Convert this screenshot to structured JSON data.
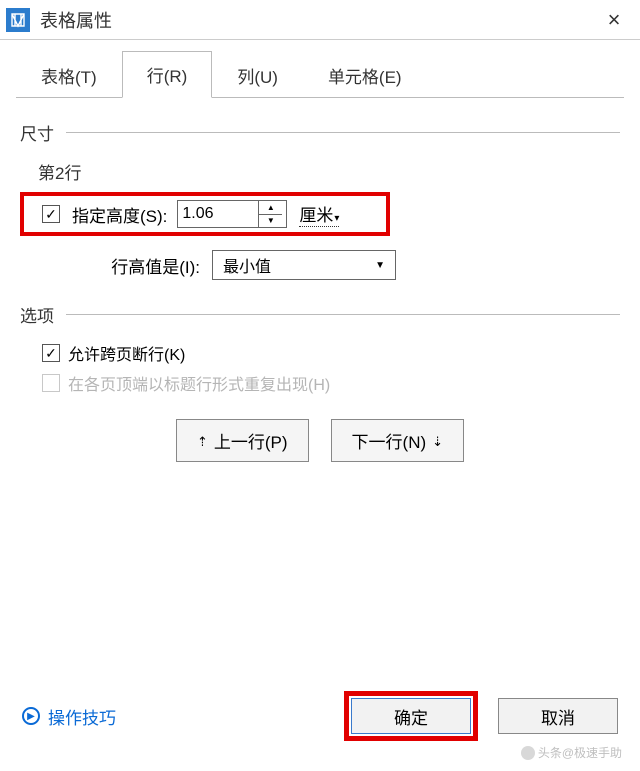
{
  "window": {
    "title": "表格属性",
    "close_symbol": "×"
  },
  "tabs": {
    "table": "表格(T)",
    "row": "行(R)",
    "column": "列(U)",
    "cell": "单元格(E)",
    "active": "row"
  },
  "size_section": {
    "header": "尺寸",
    "row_label": "第2行",
    "specify_height_label": "指定高度(S):",
    "specify_height_checked": true,
    "height_value": "1.06",
    "unit": "厘米",
    "row_height_is_label": "行高值是(I):",
    "row_height_is_value": "最小值"
  },
  "options_section": {
    "header": "选项",
    "allow_break_label": "允许跨页断行(K)",
    "allow_break_checked": true,
    "repeat_header_label": "在各页顶端以标题行形式重复出现(H)",
    "repeat_header_enabled": false
  },
  "nav": {
    "prev": "上一行(P)",
    "next": "下一行(N)"
  },
  "footer": {
    "tips": "操作技巧",
    "ok": "确定",
    "cancel": "取消"
  },
  "watermark": "头条@极速手助"
}
